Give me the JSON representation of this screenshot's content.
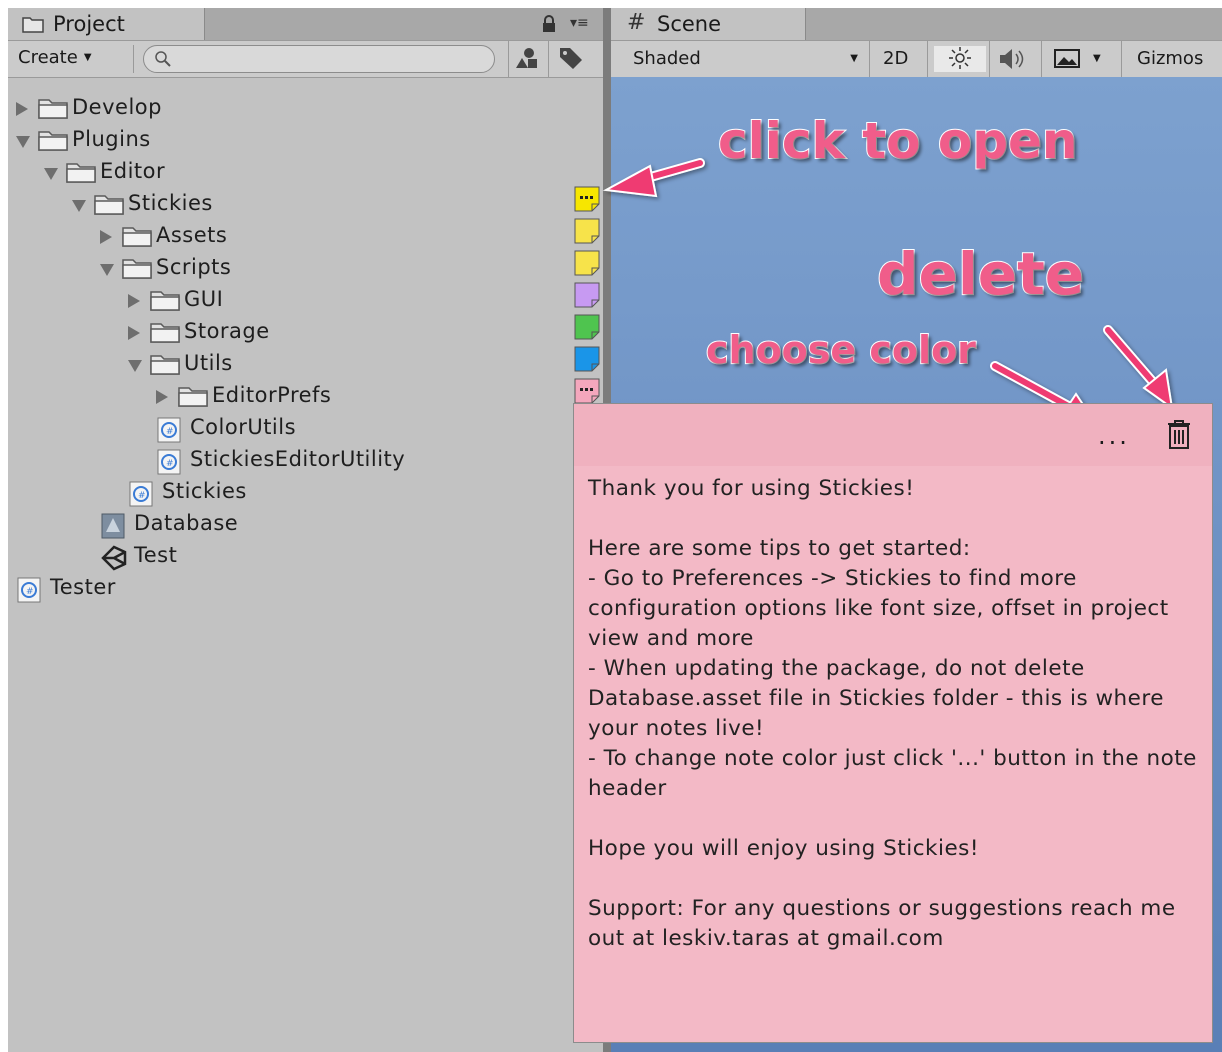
{
  "project_panel": {
    "tab_label": "Project",
    "create_label": "Create",
    "search": {
      "placeholder": "",
      "value": ""
    },
    "tree": [
      {
        "label": "Develop",
        "kind": "folder",
        "depth": 0,
        "expanded": false
      },
      {
        "label": "Plugins",
        "kind": "folder",
        "depth": 0,
        "expanded": true
      },
      {
        "label": "Editor",
        "kind": "folder",
        "depth": 1,
        "expanded": true
      },
      {
        "label": "Stickies",
        "kind": "folder",
        "depth": 2,
        "expanded": true
      },
      {
        "label": "Assets",
        "kind": "folder",
        "depth": 3,
        "expanded": false
      },
      {
        "label": "Scripts",
        "kind": "folder",
        "depth": 3,
        "expanded": true
      },
      {
        "label": "GUI",
        "kind": "folder",
        "depth": 4,
        "expanded": false
      },
      {
        "label": "Storage",
        "kind": "folder",
        "depth": 4,
        "expanded": false
      },
      {
        "label": "Utils",
        "kind": "folder",
        "depth": 4,
        "expanded": true
      },
      {
        "label": "EditorPrefs",
        "kind": "folder",
        "depth": 5,
        "expanded": false
      },
      {
        "label": "ColorUtils",
        "kind": "csharp-script",
        "depth": 5
      },
      {
        "label": "StickiesEditorUtility",
        "kind": "csharp-script",
        "depth": 5
      },
      {
        "label": "Stickies",
        "kind": "csharp-script",
        "depth": 4
      },
      {
        "label": "Database",
        "kind": "asset",
        "depth": 3
      },
      {
        "label": "Test",
        "kind": "unity-scene",
        "depth": 3
      },
      {
        "label": "Tester",
        "kind": "csharp-script",
        "depth": 0
      }
    ],
    "note_markers": [
      {
        "color": "#f7e600",
        "style": "dots"
      },
      {
        "color": "#f7e34a",
        "style": "plain"
      },
      {
        "color": "#f7e34a",
        "style": "plain"
      },
      {
        "color": "#c79af2",
        "style": "plain"
      },
      {
        "color": "#4fc44f",
        "style": "plain"
      },
      {
        "color": "#1a95e8",
        "style": "plain"
      },
      {
        "color": "#f4a7bd",
        "style": "dots"
      }
    ]
  },
  "scene_panel": {
    "tab_label": "Scene",
    "shading_mode": "Shaded",
    "mode_2d_label": "2D",
    "gizmos_label": "Gizmos",
    "background_color": "#6f93c5"
  },
  "annotations": {
    "click_to_open": "click to open",
    "delete": "delete",
    "choose_color": "choose color",
    "color": "#f05d8a"
  },
  "sticky_note": {
    "background_color": "#f3b9c6",
    "more_label": "...",
    "body": "Thank you for using Stickies!\n\nHere are some tips to get started:\n- Go to Preferences -> Stickies to find more configuration options like font size, offset in project view and more\n- When updating the package, do not delete Database.asset file in Stickies folder - this is where your notes live!\n- To change note color just click '...' button in the note header\n\nHope you will enjoy using Stickies!\n\nSupport: For any questions or suggestions reach me out at leskiv.taras at gmail.com"
  }
}
